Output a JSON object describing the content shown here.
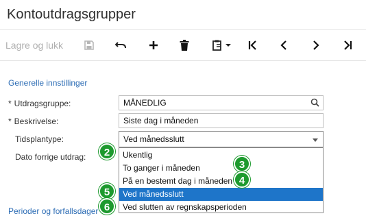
{
  "window": {
    "title": "Kontoutdragsgrupper"
  },
  "toolbar": {
    "save_close_label": "Lagre og lukk",
    "icons": [
      "save-icon",
      "undo-icon",
      "add-icon",
      "delete-icon",
      "clipboard-icon",
      "first-icon",
      "previous-icon",
      "next-icon",
      "last-icon"
    ]
  },
  "sections": {
    "general": "Generelle innstillinger",
    "periods": "Perioder og forfallsdager for utdragsforsendelse",
    "periods_visible": "Perioder og forfallsdager"
  },
  "form": {
    "statement_group": {
      "label": "Utdragsgruppe:",
      "required": "*",
      "value": "MÅNEDLIG"
    },
    "description": {
      "label": "Beskrivelse:",
      "required": "*",
      "value": "Siste dag i måneden"
    },
    "schedule_type": {
      "label": "Tidsplantype:",
      "value": "Ved månedsslutt"
    },
    "last_statement_date": {
      "label": "Dato forrige utdrag:"
    }
  },
  "dropdown": {
    "options": [
      "Ukentlig",
      "To ganger i måneden",
      "På en bestemt dag i måneden",
      "Ved månedsslutt",
      "Ved slutten av regnskapsperioden"
    ],
    "selected_index": 3
  },
  "badges": [
    "2",
    "3",
    "4",
    "5",
    "6"
  ],
  "colors": {
    "accent": "#2d6db5",
    "selected": "#1e75c9",
    "badge": "#1d9a2e"
  }
}
